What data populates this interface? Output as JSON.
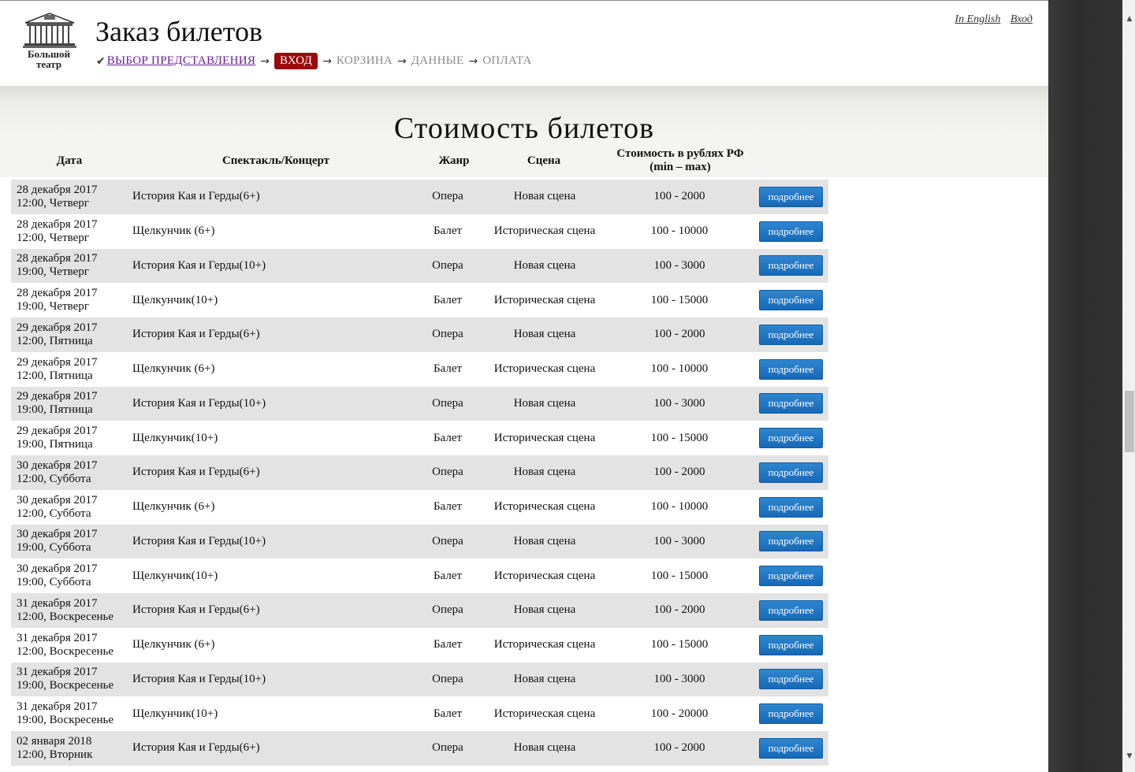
{
  "header": {
    "logo_text": "Большой театр",
    "title": "Заказ билетов",
    "breadcrumb": {
      "check": "✔",
      "step1": "ВЫБОР ПРЕДСТАВЛЕНИЯ",
      "step2": "ВХОД",
      "step3": "КОРЗИНА",
      "step4": "ДАННЫЕ",
      "step5": "ОПЛАТА",
      "arrow": "→"
    },
    "links": {
      "english": "In English",
      "login": "Вход"
    }
  },
  "main": {
    "heading": "Стоимость билетов",
    "columns": {
      "date": "Дата",
      "show": "Спектакль/Концерт",
      "genre": "Жанр",
      "stage": "Сцена",
      "price_line1": "Стоимость в рублях РФ",
      "price_line2": "(min – max)"
    },
    "button_label": "подробнее",
    "rows": [
      {
        "date": "28 декабря 2017",
        "time": "12:00, Четверг",
        "show": "История Кая и Герды(6+)",
        "genre": "Опера",
        "stage": "Новая сцена",
        "price": "100 - 2000"
      },
      {
        "date": "28 декабря 2017",
        "time": "12:00, Четверг",
        "show": "Щелкунчик (6+)",
        "genre": "Балет",
        "stage": "Историческая сцена",
        "price": "100 - 10000"
      },
      {
        "date": "28 декабря 2017",
        "time": "19:00, Четверг",
        "show": "История Кая и Герды(10+)",
        "genre": "Опера",
        "stage": "Новая сцена",
        "price": "100 - 3000"
      },
      {
        "date": "28 декабря 2017",
        "time": "19:00, Четверг",
        "show": "Щелкунчик(10+)",
        "genre": "Балет",
        "stage": "Историческая сцена",
        "price": "100 - 15000"
      },
      {
        "date": "29 декабря 2017",
        "time": "12:00, Пятница",
        "show": "История Кая и Герды(6+)",
        "genre": "Опера",
        "stage": "Новая сцена",
        "price": "100 - 2000"
      },
      {
        "date": "29 декабря 2017",
        "time": "12:00, Пятница",
        "show": "Щелкунчик (6+)",
        "genre": "Балет",
        "stage": "Историческая сцена",
        "price": "100 - 10000"
      },
      {
        "date": "29 декабря 2017",
        "time": "19:00, Пятница",
        "show": "История Кая и Герды(10+)",
        "genre": "Опера",
        "stage": "Новая сцена",
        "price": "100 - 3000"
      },
      {
        "date": "29 декабря 2017",
        "time": "19:00, Пятница",
        "show": "Щелкунчик(10+)",
        "genre": "Балет",
        "stage": "Историческая сцена",
        "price": "100 - 15000"
      },
      {
        "date": "30 декабря 2017",
        "time": "12:00, Суббота",
        "show": "История Кая и Герды(6+)",
        "genre": "Опера",
        "stage": "Новая сцена",
        "price": "100 - 2000"
      },
      {
        "date": "30 декабря 2017",
        "time": "12:00, Суббота",
        "show": "Щелкунчик (6+)",
        "genre": "Балет",
        "stage": "Историческая сцена",
        "price": "100 - 10000"
      },
      {
        "date": "30 декабря 2017",
        "time": "19:00, Суббота",
        "show": "История Кая и Герды(10+)",
        "genre": "Опера",
        "stage": "Новая сцена",
        "price": "100 - 3000"
      },
      {
        "date": "30 декабря 2017",
        "time": "19:00, Суббота",
        "show": "Щелкунчик(10+)",
        "genre": "Балет",
        "stage": "Историческая сцена",
        "price": "100 - 15000"
      },
      {
        "date": "31 декабря 2017",
        "time": "12:00, Воскресенье",
        "show": "История Кая и Герды(6+)",
        "genre": "Опера",
        "stage": "Новая сцена",
        "price": "100 - 2000"
      },
      {
        "date": "31 декабря 2017",
        "time": "12:00, Воскресенье",
        "show": "Щелкунчик (6+)",
        "genre": "Балет",
        "stage": "Историческая сцена",
        "price": "100 - 15000"
      },
      {
        "date": "31 декабря 2017",
        "time": "19:00, Воскресенье",
        "show": "История Кая и Герды(10+)",
        "genre": "Опера",
        "stage": "Новая сцена",
        "price": "100 - 3000"
      },
      {
        "date": "31 декабря 2017",
        "time": "19:00, Воскресенье",
        "show": "Щелкунчик(10+)",
        "genre": "Балет",
        "stage": "Историческая сцена",
        "price": "100 - 20000"
      },
      {
        "date": "02 января 2018",
        "time": "12:00, Вторник",
        "show": "История Кая и Герды(6+)",
        "genre": "Опера",
        "stage": "Новая сцена",
        "price": "100 - 2000"
      }
    ]
  },
  "scrollbar": {
    "up_arrow": "▲",
    "down_arrow": "▼"
  }
}
